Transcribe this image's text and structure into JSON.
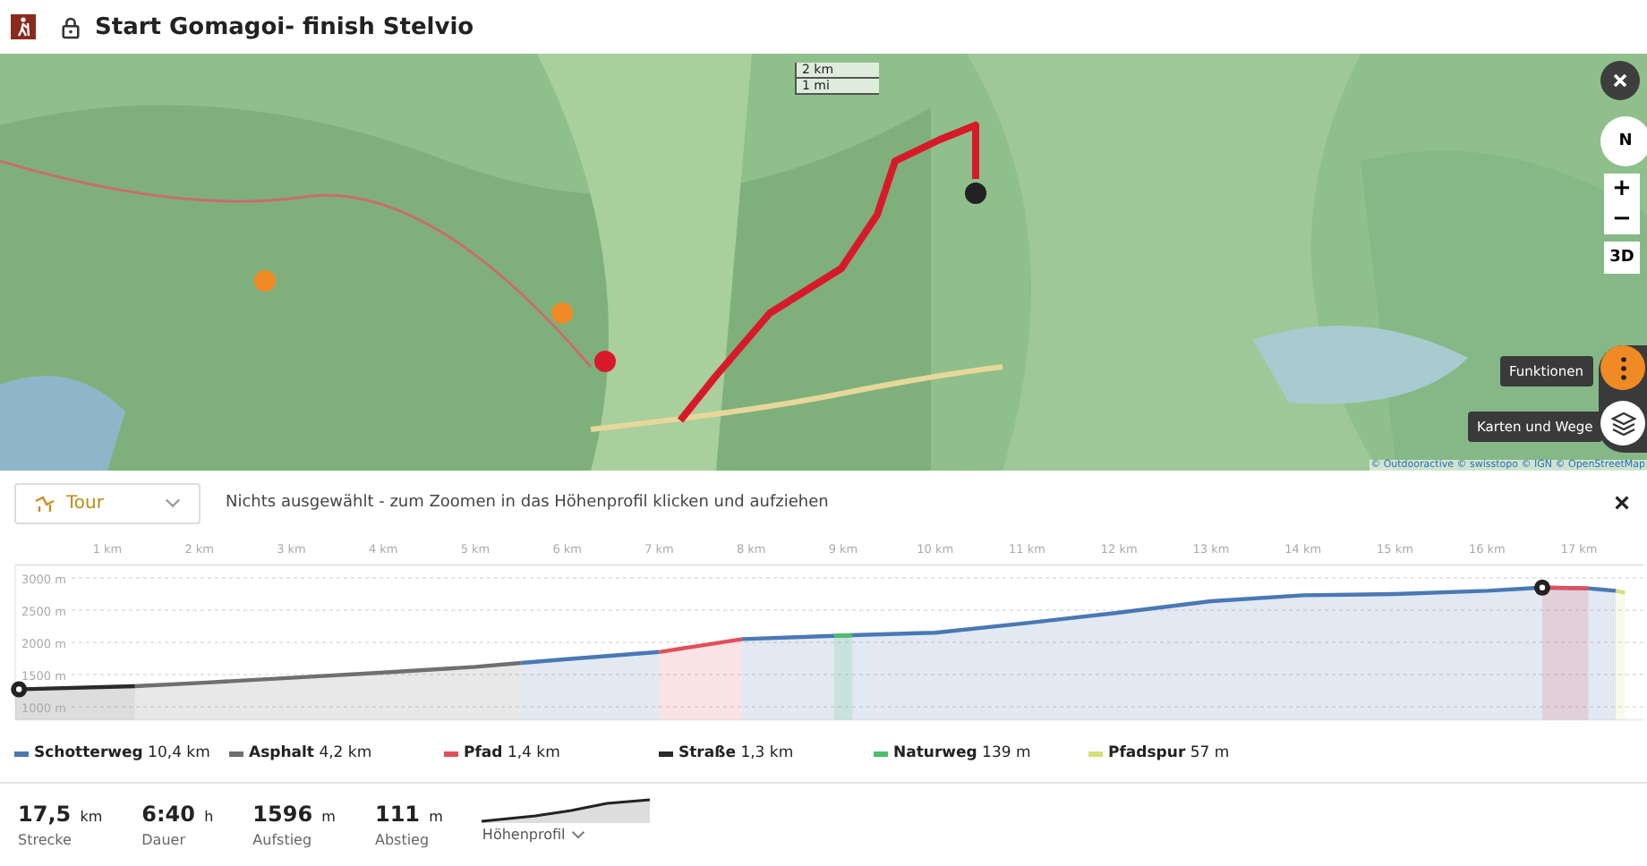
{
  "header": {
    "title": "Start Gomagoi- finish Stelvio"
  },
  "map": {
    "scale": [
      "2 km",
      "1 mi"
    ],
    "compass": "N",
    "zoom_in": "+",
    "zoom_out": "−",
    "view_3d": "3D",
    "functions_tooltip": "Funktionen",
    "layers_tooltip": "Karten und Wege",
    "attribution": "© Outdooractive © swisstopo © IGN © OpenStreetMap"
  },
  "toolbar": {
    "dropdown": "Tour",
    "hint": "Nichts ausgewählt - zum Zoomen in das Höhenprofil klicken und aufziehen"
  },
  "chart_data": {
    "type": "area",
    "grid": true,
    "x": [
      0,
      1.3,
      2,
      3,
      4,
      5,
      5.5,
      6,
      7,
      7.5,
      7.9,
      8.9,
      9.1,
      10,
      11,
      12,
      13,
      14,
      15,
      16,
      16.6,
      17.1,
      17.4,
      17.5
    ],
    "series": [
      {
        "name": "Schotterweg",
        "color": "#4a78b5",
        "values": [
          null,
          null,
          null,
          null,
          null,
          null,
          1680,
          1740,
          1850,
          null,
          2050,
          2100,
          2110,
          2150,
          2300,
          2460,
          2640,
          2730,
          2750,
          2800,
          2850,
          2840,
          2800,
          null
        ]
      },
      {
        "name": "Asphalt",
        "color": "#6f6f6f",
        "values": [
          null,
          1320,
          1370,
          1450,
          1530,
          1620,
          1680,
          null,
          null,
          null,
          null,
          null,
          null,
          null,
          null,
          null,
          null,
          null,
          null,
          null,
          null,
          null,
          null,
          null
        ]
      },
      {
        "name": "Pfad",
        "color": "#e0505a",
        "values": [
          null,
          null,
          null,
          null,
          null,
          null,
          null,
          null,
          1850,
          1960,
          2050,
          null,
          null,
          null,
          null,
          null,
          null,
          null,
          null,
          null,
          2850,
          2840,
          null,
          null
        ]
      },
      {
        "name": "Straße",
        "color": "#2b2b2b",
        "values": [
          1270,
          1320,
          null,
          null,
          null,
          null,
          null,
          null,
          null,
          null,
          null,
          null,
          null,
          null,
          null,
          null,
          null,
          null,
          null,
          null,
          null,
          null,
          null,
          null
        ]
      },
      {
        "name": "Naturweg",
        "color": "#4cbf6a",
        "values": [
          null,
          null,
          null,
          null,
          null,
          null,
          null,
          null,
          null,
          null,
          null,
          2100,
          2110,
          null,
          null,
          null,
          null,
          null,
          null,
          null,
          null,
          null,
          null,
          null
        ]
      },
      {
        "name": "Pfadspur",
        "color": "#d4e07a",
        "values": [
          null,
          null,
          null,
          null,
          null,
          null,
          null,
          null,
          null,
          null,
          null,
          null,
          null,
          null,
          null,
          null,
          null,
          null,
          null,
          null,
          null,
          null,
          2800,
          2770
        ]
      }
    ],
    "xlim": [
      0,
      17.7
    ],
    "ylim": [
      800,
      3200
    ],
    "xticks": [
      {
        "value": 1,
        "label": "1 km"
      },
      {
        "value": 2,
        "label": "2 km"
      },
      {
        "value": 3,
        "label": "3 km"
      },
      {
        "value": 4,
        "label": "4 km"
      },
      {
        "value": 5,
        "label": "5 km"
      },
      {
        "value": 6,
        "label": "6 km"
      },
      {
        "value": 7,
        "label": "7 km"
      },
      {
        "value": 8,
        "label": "8 km"
      },
      {
        "value": 9,
        "label": "9 km"
      },
      {
        "value": 10,
        "label": "10 km"
      },
      {
        "value": 11,
        "label": "11 km"
      },
      {
        "value": 12,
        "label": "12 km"
      },
      {
        "value": 13,
        "label": "13 km"
      },
      {
        "value": 14,
        "label": "14 km"
      },
      {
        "value": 15,
        "label": "15 km"
      },
      {
        "value": 16,
        "label": "16 km"
      },
      {
        "value": 17,
        "label": "17 km"
      }
    ],
    "yticks": [
      {
        "value": 1000,
        "label": "1000 m"
      },
      {
        "value": 1500,
        "label": "1500 m"
      },
      {
        "value": 2000,
        "label": "2000 m"
      },
      {
        "value": 2500,
        "label": "2500 m"
      },
      {
        "value": 3000,
        "label": "3000 m"
      }
    ]
  },
  "legend": [
    {
      "length": "10,4 km"
    },
    {
      "length": "4,2 km"
    },
    {
      "length": "1,4 km"
    },
    {
      "length": "1,3 km"
    },
    {
      "length": "139 m"
    },
    {
      "length": "57 m"
    }
  ],
  "stats": [
    {
      "value": "17,5",
      "unit": "km",
      "label": "Strecke"
    },
    {
      "value": "6:40",
      "unit": "h",
      "label": "Dauer"
    },
    {
      "value": "1596",
      "unit": "m",
      "label": "Aufstieg"
    },
    {
      "value": "111",
      "unit": "m",
      "label": "Abstieg"
    }
  ],
  "profile_toggle": "Höhenprofil"
}
